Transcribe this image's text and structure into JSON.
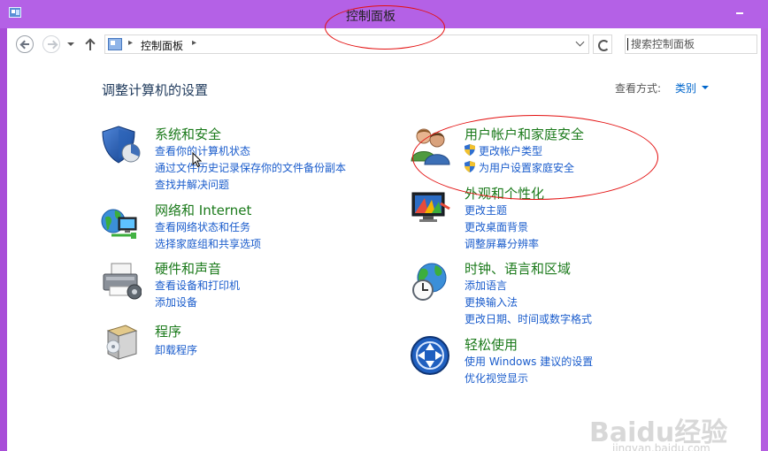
{
  "window": {
    "title": "控制面板"
  },
  "navigation": {
    "address_crumb": "控制面板",
    "address_separator": "▸",
    "search_placeholder": "搜索控制面板"
  },
  "main": {
    "page_title": "调整计算机的设置",
    "view_by_label": "查看方式:",
    "view_by_value": "类别"
  },
  "categories": {
    "system_security": {
      "title": "系统和安全",
      "links": [
        "查看你的计算机状态",
        "通过文件历史记录保存你的文件备份副本",
        "查找并解决问题"
      ]
    },
    "network_internet": {
      "title": "网络和 Internet",
      "links": [
        "查看网络状态和任务",
        "选择家庭组和共享选项"
      ]
    },
    "hardware_sound": {
      "title": "硬件和声音",
      "links": [
        "查看设备和打印机",
        "添加设备"
      ]
    },
    "programs": {
      "title": "程序",
      "links": [
        "卸载程序"
      ]
    },
    "user_accounts": {
      "title": "用户帐户和家庭安全",
      "links": [
        "更改帐户类型",
        "为用户设置家庭安全"
      ]
    },
    "appearance": {
      "title": "外观和个性化",
      "links": [
        "更改主题",
        "更改桌面背景",
        "调整屏幕分辨率"
      ]
    },
    "clock_language": {
      "title": "时钟、语言和区域",
      "links": [
        "添加语言",
        "更换输入法",
        "更改日期、时间或数字格式"
      ]
    },
    "ease_of_access": {
      "title": "轻松使用",
      "links": [
        "使用 Windows 建议的设置",
        "优化视觉显示"
      ]
    }
  },
  "watermark": {
    "brand": "Baidu经验",
    "url": "jingyan.baidu.com"
  },
  "colors": {
    "titlebar": "#b461e6",
    "category_title": "#1b7a1b",
    "link": "#1a5ccc",
    "annotation": "#e31010"
  }
}
